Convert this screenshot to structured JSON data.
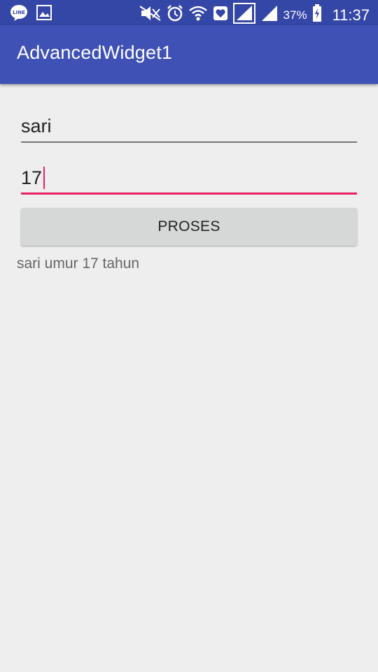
{
  "status_bar": {
    "left_icons": [
      "line-app-icon",
      "gallery-icon"
    ],
    "right_icons": [
      "mute-icon",
      "alarm-icon",
      "wifi-icon",
      "heart-icon",
      "signal-icon",
      "signal-icon-2"
    ],
    "battery_percent": "37%",
    "time": "11:37"
  },
  "app_bar": {
    "title": "AdvancedWidget1",
    "color": "#3f51b5"
  },
  "form": {
    "name_value": "sari",
    "age_value": "17",
    "accent_color": "#e91e63",
    "button_label": "PROSES",
    "result_text": "sari umur 17 tahun"
  }
}
